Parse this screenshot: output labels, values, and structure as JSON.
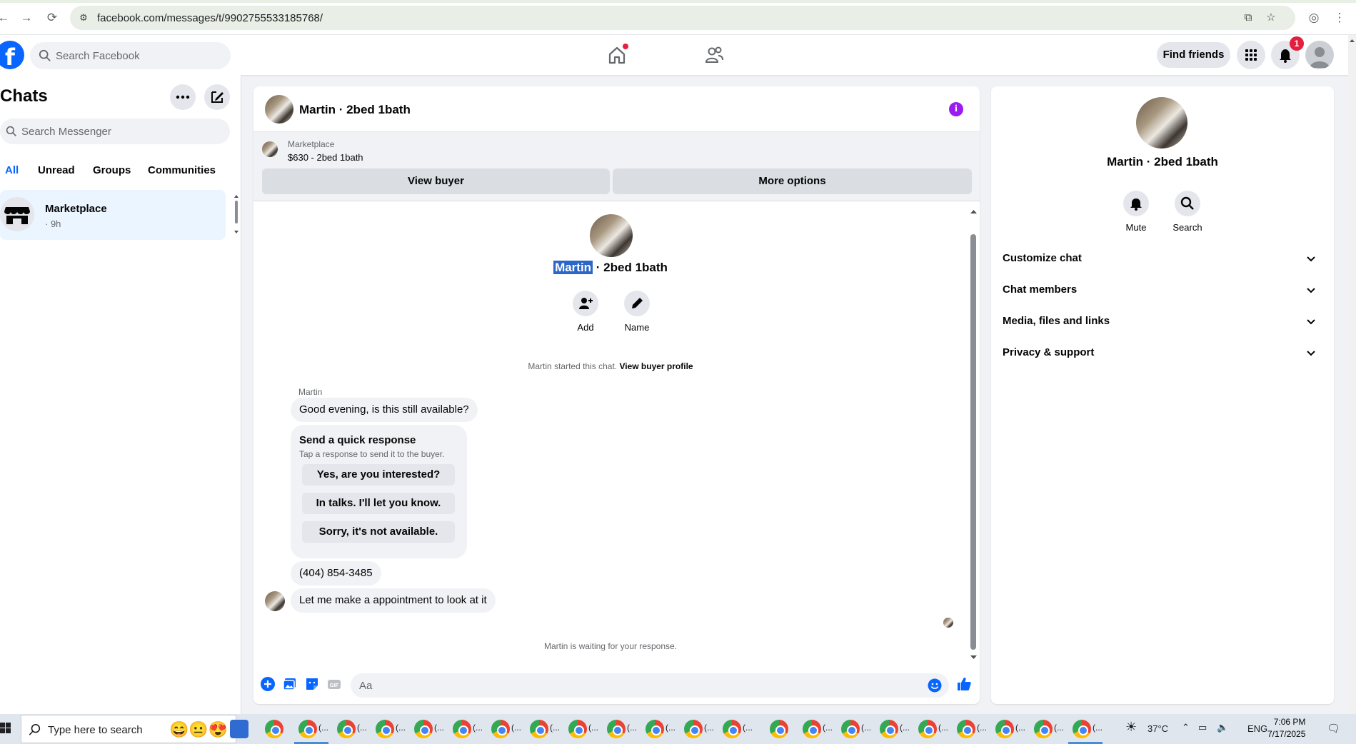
{
  "browser": {
    "url": "facebook.com/messages/t/9902755533185768/"
  },
  "header": {
    "search_placeholder": "Search Facebook",
    "find_friends_label": "Find friends",
    "notification_count": "1"
  },
  "sidebar": {
    "title": "Chats",
    "search_placeholder": "Search Messenger",
    "tabs": [
      {
        "label": "All",
        "active": true
      },
      {
        "label": "Unread"
      },
      {
        "label": "Groups"
      },
      {
        "label": "Communities"
      }
    ],
    "chats": [
      {
        "name": "Marketplace",
        "time": "· 9h"
      }
    ]
  },
  "chat": {
    "title": "Martin · 2bed 1bath",
    "banner": {
      "source": "Marketplace",
      "listing": "$630 - 2bed 1bath",
      "view_buyer_label": "View buyer",
      "more_options_label": "More options"
    },
    "intro": {
      "name_highlight": "Martin",
      "name_rest": " · 2bed 1bath",
      "add_label": "Add",
      "name_label": "Name"
    },
    "started_text": "Martin started this chat.",
    "view_buyer_profile": "View buyer profile",
    "sender": "Martin",
    "messages": [
      "Good evening, is this still available?",
      "(404) 854-3485",
      "Let me make a appointment to look at it"
    ],
    "quick_response": {
      "title": "Send a quick response",
      "subtitle": "Tap a response to send it to the buyer.",
      "options": [
        "Yes, are you interested?",
        "In talks. I'll let you know.",
        "Sorry, it's not available."
      ]
    },
    "waiting_text": "Martin is waiting for your response.",
    "composer_placeholder": "Aa"
  },
  "details": {
    "name": "Martin · 2bed 1bath",
    "mute_label": "Mute",
    "search_label": "Search",
    "sections": [
      "Customize chat",
      "Chat members",
      "Media, files and links",
      "Privacy & support"
    ]
  },
  "taskbar": {
    "search_placeholder": "Type here to search",
    "temperature": "37°C",
    "language": "ENG",
    "time": "7:06 PM",
    "date": "7/17/2025",
    "app_label": "(..."
  },
  "colors": {
    "accent": "#0866ff",
    "info": "#9b1cf0",
    "alert": "#e41e3f"
  }
}
